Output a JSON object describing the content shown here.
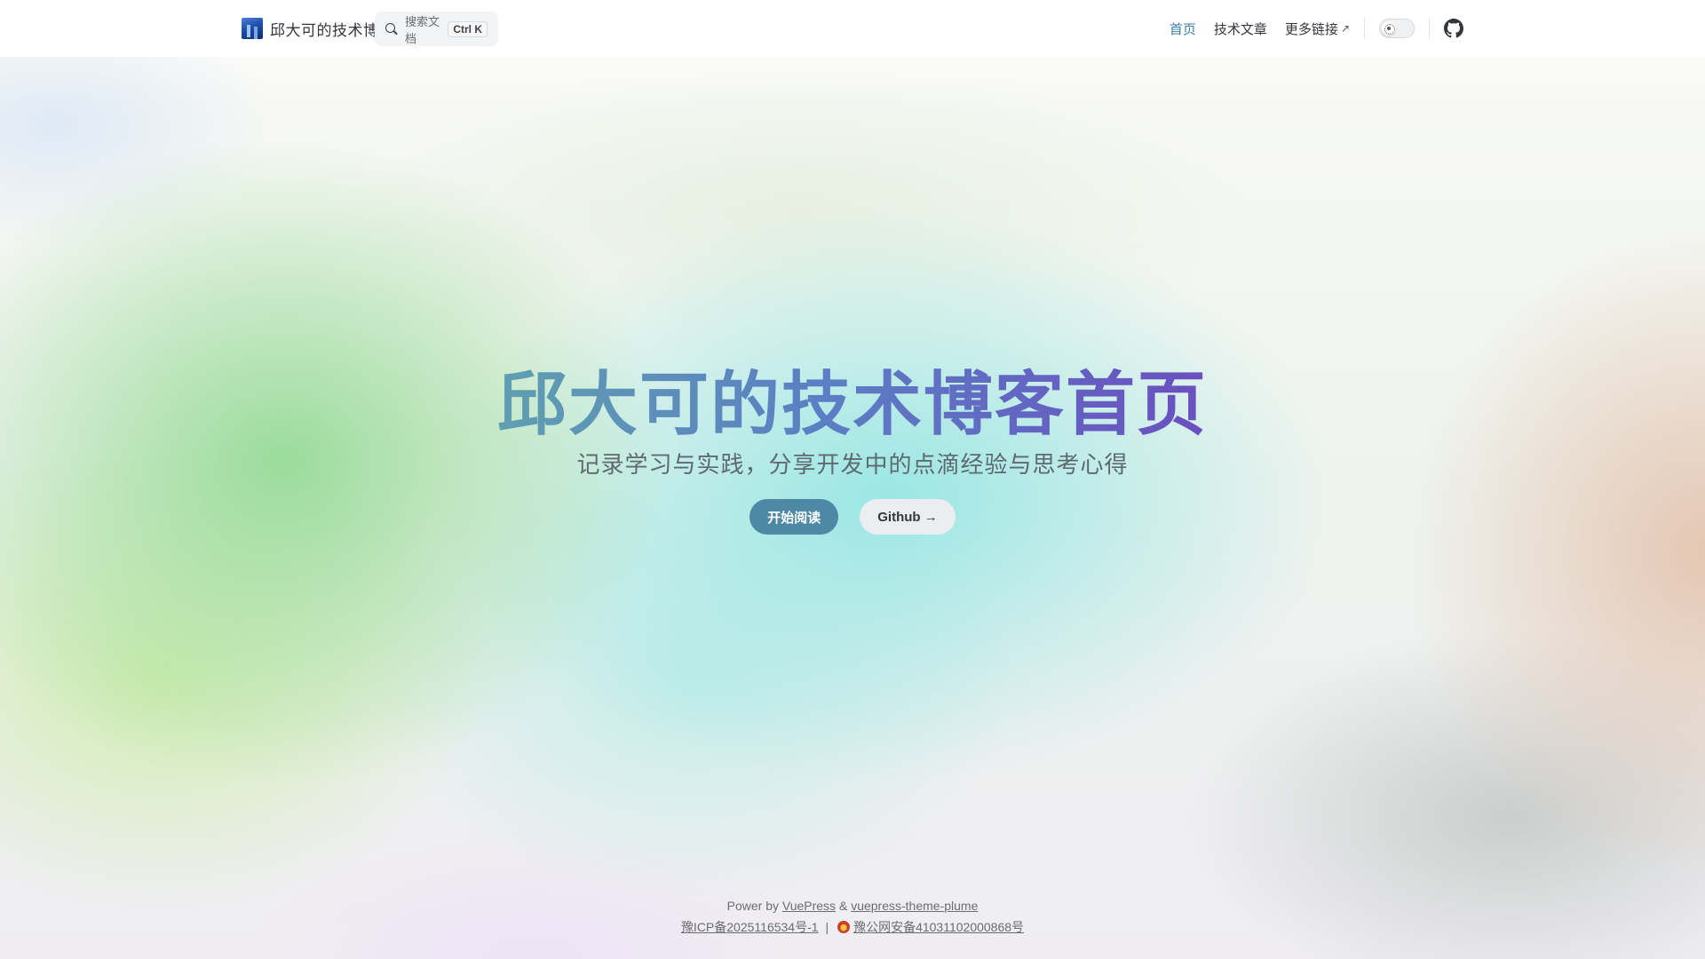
{
  "nav": {
    "site_title": "邱大可的技术博客",
    "search_placeholder": "搜索文档",
    "search_kbd": "Ctrl K",
    "links": [
      {
        "label": "首页",
        "active": true,
        "external": false
      },
      {
        "label": "技术文章",
        "active": false,
        "external": false
      },
      {
        "label": "更多链接",
        "active": false,
        "external": true
      }
    ],
    "external_arrow": "↗",
    "theme_toggle_icon": "sun-icon",
    "repo_icon": "github-icon"
  },
  "hero": {
    "title": "邱大可的技术博客首页",
    "subtitle": "记录学习与实践，分享开发中的点滴经验与思考心得",
    "primary_button": "开始阅读",
    "secondary_button": "Github →"
  },
  "footer": {
    "power_prefix": "Power by",
    "vuepress": "VuePress",
    "amp": "&",
    "theme": "vuepress-theme-plume",
    "icp": "豫ICP备2025116534号-1",
    "pipe": "|",
    "police": "豫公网安备41031102000868号"
  },
  "colors": {
    "accent": "#4d88a4",
    "active_link": "#3b7ea1",
    "title_gradient_start": "#5f9fb0",
    "title_gradient_end": "#6a4fc0"
  }
}
